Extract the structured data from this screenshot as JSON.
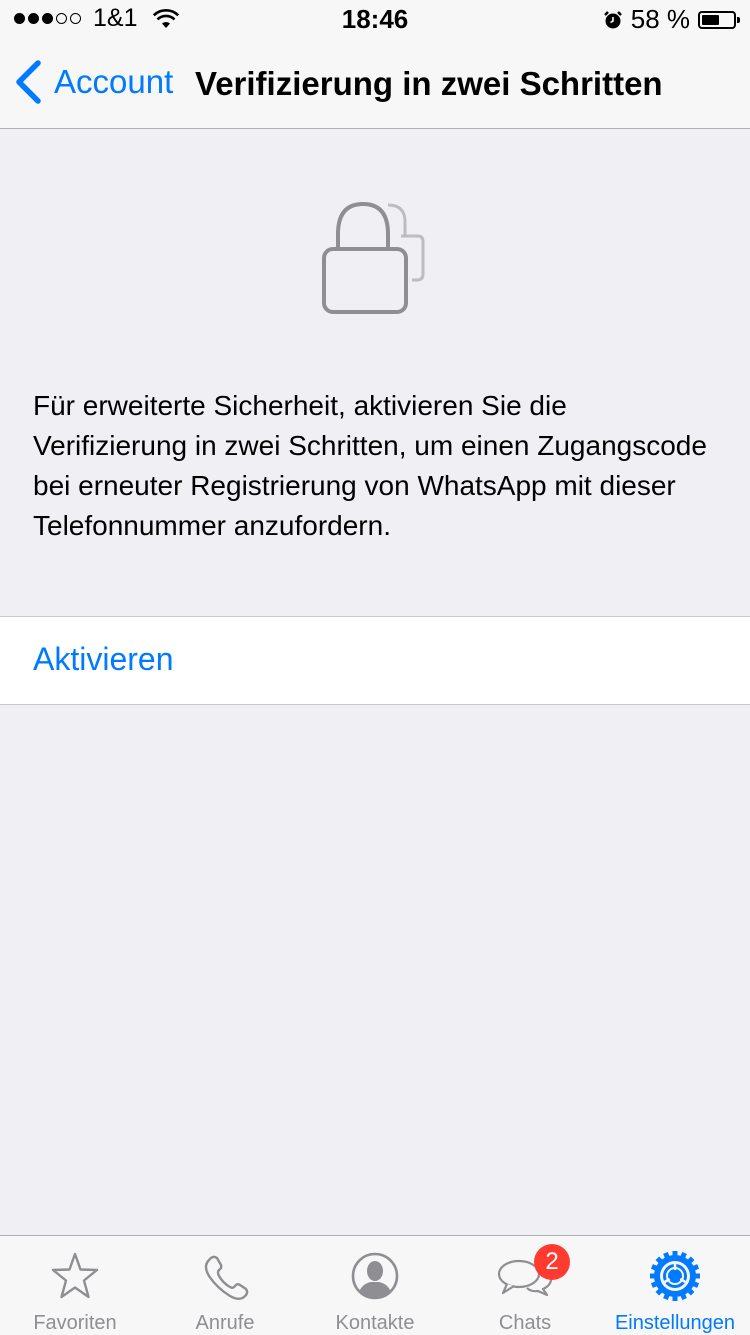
{
  "status_bar": {
    "signal_strength": 3,
    "signal_max": 5,
    "carrier": "1&1",
    "time": "18:46",
    "alarm_icon": "alarm-clock-icon",
    "battery_percent_label": "58 %",
    "battery_level": 0.58
  },
  "nav": {
    "back_label": "Account",
    "title": "Verifizierung in zwei Schritten"
  },
  "main": {
    "icon": "two-locks-icon",
    "description": "Für erweiterte Sicherheit, aktivieren Sie die Verifizierung in zwei Schritten, um einen Zugangscode bei erneuter Registrierung von WhatsApp mit dieser Telefonnummer anzufordern.",
    "action_label": "Aktivieren"
  },
  "colors": {
    "accent": "#007aff",
    "badge": "#ff3b30",
    "background": "#efeff4"
  },
  "tabs": [
    {
      "label": "Favoriten",
      "icon": "star-icon",
      "active": false
    },
    {
      "label": "Anrufe",
      "icon": "phone-icon",
      "active": false
    },
    {
      "label": "Kontakte",
      "icon": "contact-icon",
      "active": false
    },
    {
      "label": "Chats",
      "icon": "chat-bubbles-icon",
      "active": false,
      "badge": "2"
    },
    {
      "label": "Einstellungen",
      "icon": "gear-icon",
      "active": true
    }
  ]
}
